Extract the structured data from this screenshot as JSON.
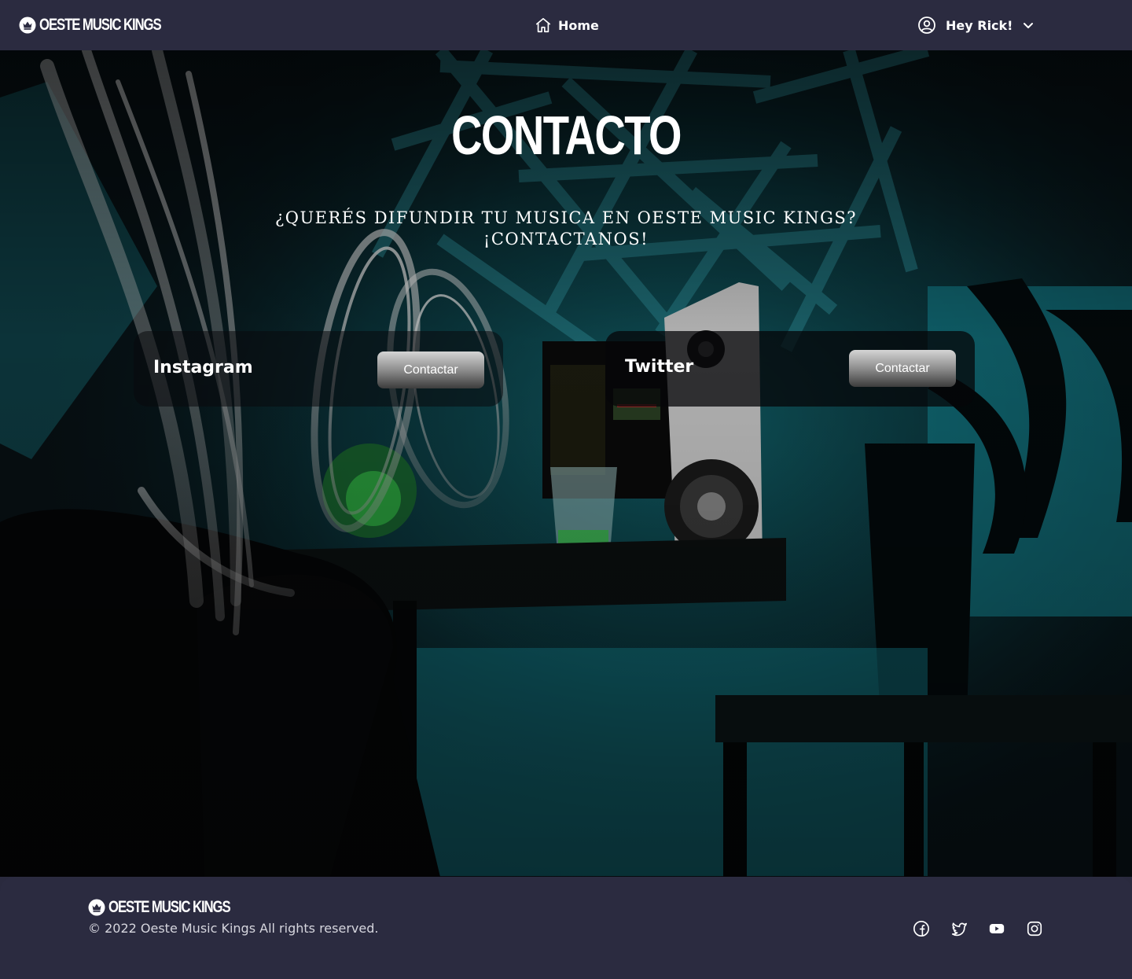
{
  "header": {
    "brand": "OESTE MUSIC KINGS",
    "home_label": "Home",
    "user_greeting": "Hey Rick!"
  },
  "main": {
    "title": "CONTACTO",
    "subtitle_line1": "¿Querés difundir tu musica en Oeste Music Kings?",
    "subtitle_line2": "¡Contactanos!",
    "cards": [
      {
        "name": "Instagram",
        "button_label": "Contactar"
      },
      {
        "name": "Twitter",
        "button_label": "Contactar"
      }
    ]
  },
  "footer": {
    "brand": "OESTE MUSIC KINGS",
    "copyright": "© 2022 Oeste Music Kings All rights reserved.",
    "social_icons": [
      "facebook-icon",
      "twitter-icon",
      "youtube-icon",
      "instagram-icon"
    ]
  },
  "colors": {
    "navbar_bg": "#2b2b40",
    "accent_teal": "#1aa8b4"
  }
}
